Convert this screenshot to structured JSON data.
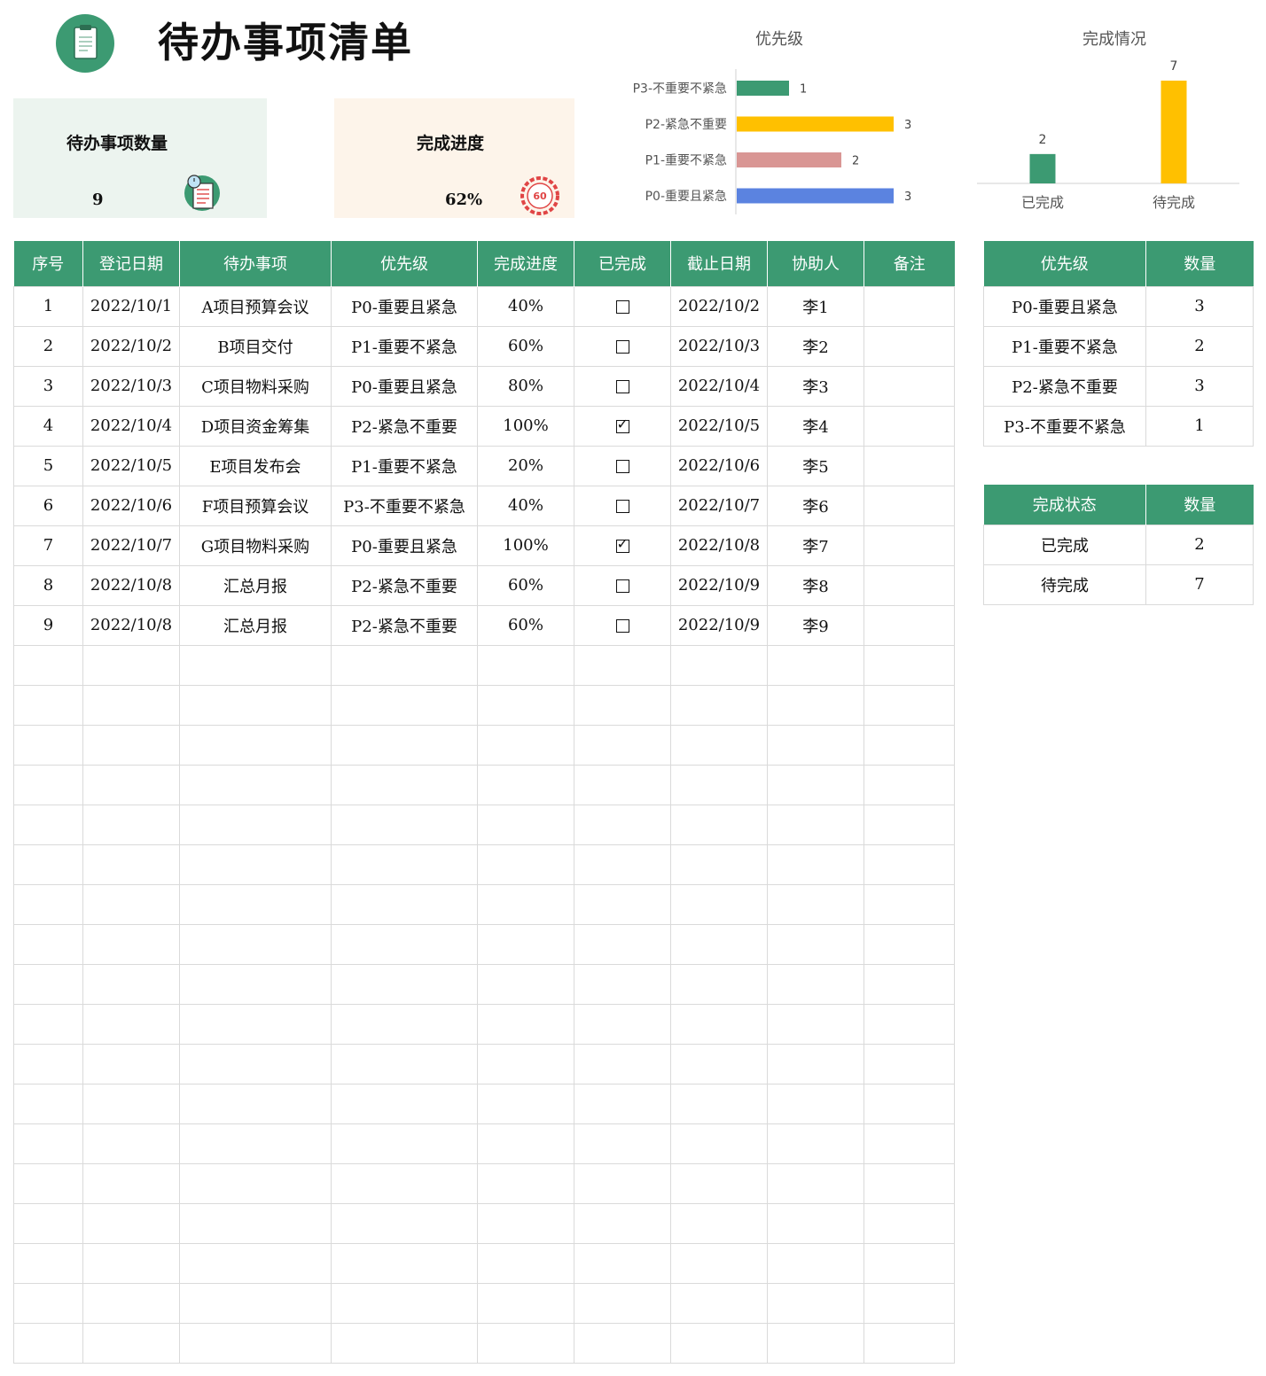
{
  "header": {
    "title": "待办事项清单",
    "icon": "clipboard-icon"
  },
  "cards": {
    "count": {
      "label": "待办事项数量",
      "value": "9",
      "icon": "checklist-icon"
    },
    "progress": {
      "label": "完成进度",
      "value": "62%",
      "icon": "gauge-icon",
      "gauge_text": "60"
    }
  },
  "colors": {
    "green": "#3c9a72",
    "yellow": "#ffc000",
    "pink": "#d99694",
    "blue": "#5b83e0"
  },
  "chart_data": [
    {
      "type": "bar",
      "orientation": "horizontal",
      "title": "优先级",
      "categories": [
        "P3-不重要不紧急",
        "P2-紧急不重要",
        "P1-重要不紧急",
        "P0-重要且紧急"
      ],
      "values": [
        1,
        3,
        2,
        3
      ],
      "bar_colors": [
        "#3c9a72",
        "#ffc000",
        "#d99694",
        "#5b83e0"
      ],
      "xlim": [
        0,
        3
      ],
      "grid": false,
      "legend": "none"
    },
    {
      "type": "bar",
      "orientation": "vertical",
      "title": "完成情况",
      "categories": [
        "已完成",
        "待完成"
      ],
      "values": [
        2,
        7
      ],
      "bar_colors": [
        "#3c9a72",
        "#ffc000"
      ],
      "ylim": [
        0,
        7
      ],
      "grid": false,
      "legend": "none"
    }
  ],
  "main_table": {
    "headers": [
      "序号",
      "登记日期",
      "待办事项",
      "优先级",
      "完成进度",
      "已完成",
      "截止日期",
      "协助人",
      "备注"
    ],
    "rows": [
      {
        "no": "1",
        "date": "2022/10/1",
        "task": "A项目预算会议",
        "priority": "P0-重要且紧急",
        "progress": "40%",
        "done": false,
        "due": "2022/10/2",
        "helper": "李1",
        "note": ""
      },
      {
        "no": "2",
        "date": "2022/10/2",
        "task": "B项目交付",
        "priority": "P1-重要不紧急",
        "progress": "60%",
        "done": false,
        "due": "2022/10/3",
        "helper": "李2",
        "note": ""
      },
      {
        "no": "3",
        "date": "2022/10/3",
        "task": "C项目物料采购",
        "priority": "P0-重要且紧急",
        "progress": "80%",
        "done": false,
        "due": "2022/10/4",
        "helper": "李3",
        "note": ""
      },
      {
        "no": "4",
        "date": "2022/10/4",
        "task": "D项目资金筹集",
        "priority": "P2-紧急不重要",
        "progress": "100%",
        "done": true,
        "due": "2022/10/5",
        "helper": "李4",
        "note": ""
      },
      {
        "no": "5",
        "date": "2022/10/5",
        "task": "E项目发布会",
        "priority": "P1-重要不紧急",
        "progress": "20%",
        "done": false,
        "due": "2022/10/6",
        "helper": "李5",
        "note": ""
      },
      {
        "no": "6",
        "date": "2022/10/6",
        "task": "F项目预算会议",
        "priority": "P3-不重要不紧急",
        "progress": "40%",
        "done": false,
        "due": "2022/10/7",
        "helper": "李6",
        "note": ""
      },
      {
        "no": "7",
        "date": "2022/10/7",
        "task": "G项目物料采购",
        "priority": "P0-重要且紧急",
        "progress": "100%",
        "done": true,
        "due": "2022/10/8",
        "helper": "李7",
        "note": ""
      },
      {
        "no": "8",
        "date": "2022/10/8",
        "task": "汇总月报",
        "priority": "P2-紧急不重要",
        "progress": "60%",
        "done": false,
        "due": "2022/10/9",
        "helper": "李8",
        "note": ""
      },
      {
        "no": "9",
        "date": "2022/10/8",
        "task": "汇总月报",
        "priority": "P2-紧急不重要",
        "progress": "60%",
        "done": false,
        "due": "2022/10/9",
        "helper": "李9",
        "note": ""
      }
    ]
  },
  "priority_table": {
    "headers": [
      "优先级",
      "数量"
    ],
    "rows": [
      {
        "name": "P0-重要且紧急",
        "count": "3"
      },
      {
        "name": "P1-重要不紧急",
        "count": "2"
      },
      {
        "name": "P2-紧急不重要",
        "count": "3"
      },
      {
        "name": "P3-不重要不紧急",
        "count": "1"
      }
    ]
  },
  "status_table": {
    "headers": [
      "完成状态",
      "数量"
    ],
    "rows": [
      {
        "name": "已完成",
        "count": "2"
      },
      {
        "name": "待完成",
        "count": "7"
      }
    ]
  }
}
